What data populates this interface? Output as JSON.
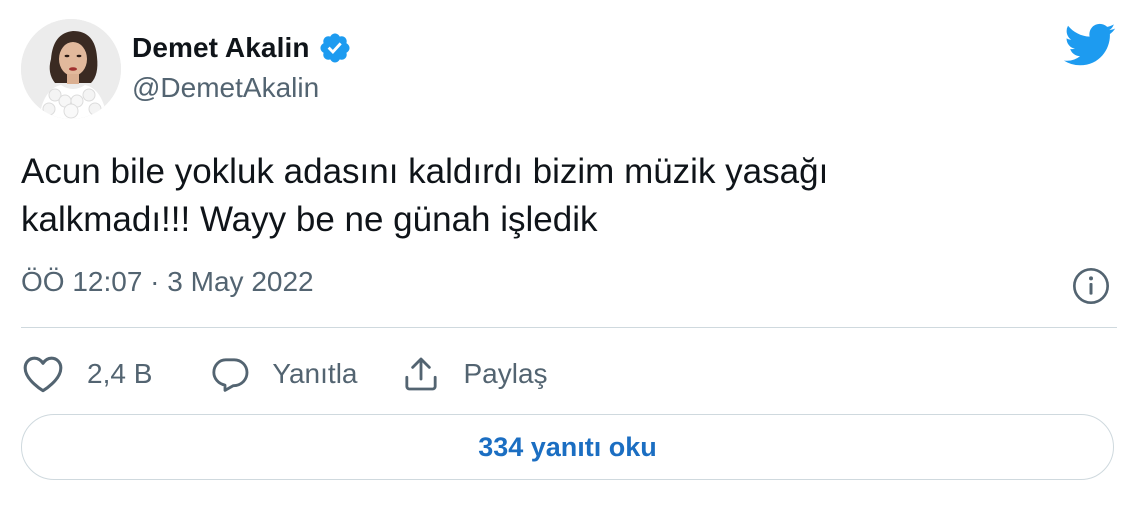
{
  "user": {
    "display_name": "Demet Akalin",
    "handle": "@DemetAkalin",
    "verified": true,
    "avatar_icon": "profile-photo"
  },
  "tweet": {
    "text_line1": "Acun bile yokluk adasını kaldırdı bizim müzik yasağı",
    "text_line2": "kalkmadı!!! Wayy be ne günah işledik",
    "timestamp": "ÖÖ 12:07 · 3 May 2022"
  },
  "actions": {
    "like_count": "2,4 B",
    "reply_label": "Yanıtla",
    "share_label": "Paylaş"
  },
  "replies_button": {
    "label": "334 yanıtı oku"
  },
  "icons": {
    "brand": "twitter-bird-icon",
    "info": "info-icon",
    "like": "heart-icon",
    "reply": "speech-bubble-icon",
    "share": "share-upload-icon",
    "verified": "verified-badge-icon"
  },
  "colors": {
    "brand_blue": "#1d9bf0",
    "link_blue": "#1b6ec2",
    "text_primary": "#0f1419",
    "text_secondary": "#536471",
    "border": "#cfd9de"
  }
}
